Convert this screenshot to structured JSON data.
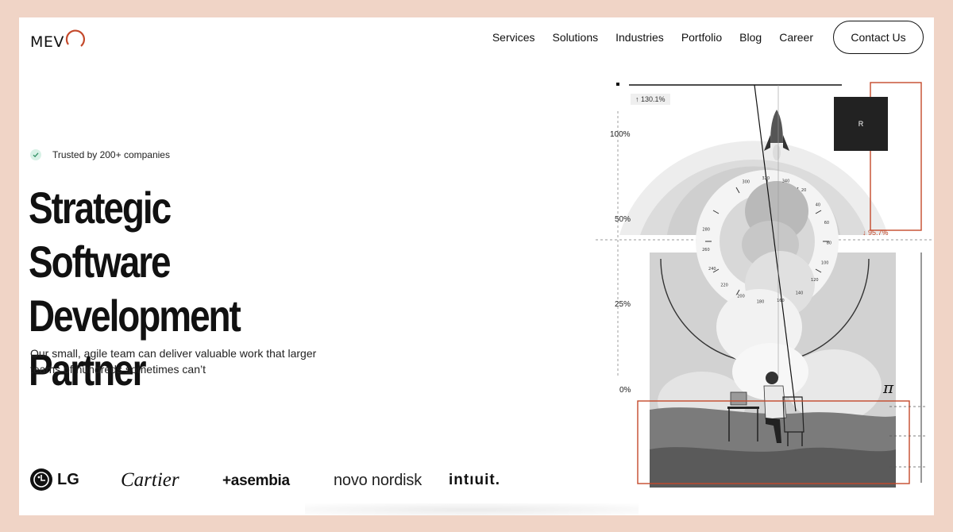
{
  "header": {
    "logo": "MEV",
    "nav": [
      "Services",
      "Solutions",
      "Industries",
      "Portfolio",
      "Blog",
      "Career"
    ],
    "cta": "Contact Us"
  },
  "hero": {
    "trusted": "Trusted by 200+ companies",
    "headline": [
      "Strategic Software",
      "Development",
      "Partner"
    ],
    "subtext": "Our small, agile team can deliver valuable work that larger teams of hundreds sometimes can’t"
  },
  "client_logos": {
    "lg": "LG",
    "cartier": "Cartier",
    "asembia": "+asembia",
    "novo": "novo nordisk",
    "intuit": "intıuit."
  },
  "graphic": {
    "y_labels": [
      "100%",
      "50%",
      "25%",
      "0%"
    ],
    "badge_up": "↑ 130.1%",
    "r_label": "R",
    "down_pct": "↓ 95.7%",
    "pi": "π",
    "dial_ticks": [
      "300",
      "320",
      "340",
      "20",
      "40",
      "60",
      "80",
      "100",
      "120",
      "140",
      "160",
      "180",
      "200",
      "220",
      "240",
      "260",
      "280"
    ],
    "accent": "#c4492b"
  }
}
